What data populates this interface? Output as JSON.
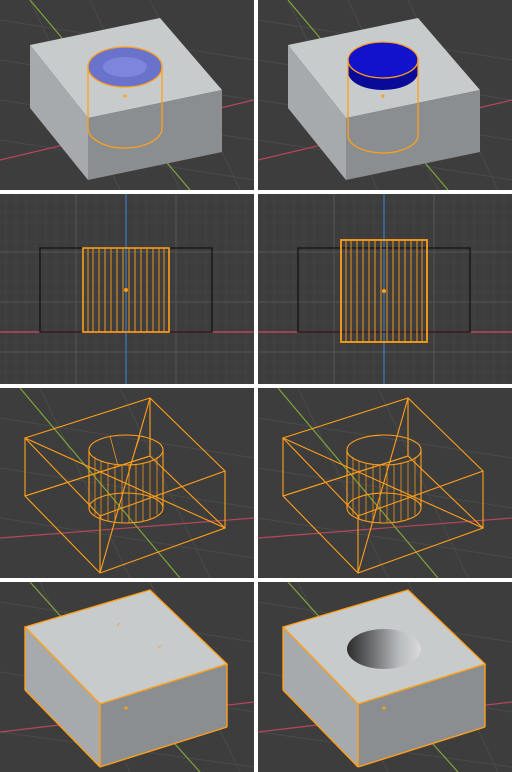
{
  "colors": {
    "background": "#3d3d3d",
    "grid_line": "#4a4a4a",
    "x_axis": "#b5475a",
    "y_axis": "#7fa33a",
    "z_axis": "#3b6ea8",
    "selection": "#ff9f1a",
    "cube_top": "#c8cbcc",
    "cube_left": "#a6aaac",
    "cube_right": "#8a8e90",
    "boolean_cap": "#1212cc",
    "divider": "#ffffff"
  },
  "panels": [
    {
      "id": "solid-perspective-cutter-transparent",
      "view": "perspective-solid"
    },
    {
      "id": "solid-perspective-cutter-blue-cap",
      "view": "perspective-solid"
    },
    {
      "id": "front-ortho-wire-small",
      "view": "front-orthographic-wire"
    },
    {
      "id": "front-ortho-wire-large",
      "view": "front-orthographic-wire"
    },
    {
      "id": "perspective-wireframe-a",
      "view": "perspective-wireframe"
    },
    {
      "id": "perspective-wireframe-b",
      "view": "perspective-wireframe"
    },
    {
      "id": "result-cube-no-hole",
      "view": "perspective-solid-result"
    },
    {
      "id": "result-cube-with-hole",
      "view": "perspective-solid-result"
    }
  ]
}
